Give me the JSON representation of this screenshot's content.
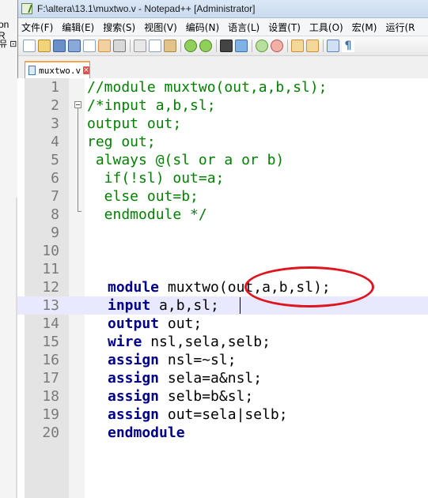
{
  "background_window": {
    "text_line_1": "on R",
    "text_line_2": "뮤 ⊡"
  },
  "window": {
    "title": "F:\\altera\\13.1\\muxtwo.v - Notepad++ [Administrator]"
  },
  "menu": [
    {
      "label": "文件(F)"
    },
    {
      "label": "编辑(E)"
    },
    {
      "label": "搜索(S)"
    },
    {
      "label": "视图(V)"
    },
    {
      "label": "编码(N)"
    },
    {
      "label": "语言(L)"
    },
    {
      "label": "设置(T)"
    },
    {
      "label": "工具(O)"
    },
    {
      "label": "宏(M)"
    },
    {
      "label": "运行(R"
    }
  ],
  "toolbar": {
    "buttons": [
      "new-file",
      "open-file",
      "save",
      "save-all",
      "close",
      "close-all",
      "print",
      "cut",
      "copy",
      "paste",
      "undo",
      "redo",
      "find",
      "replace",
      "zoom-in",
      "zoom-out",
      "sync-v",
      "sync-h",
      "word-wrap",
      "show-all-chars"
    ]
  },
  "tab": {
    "label": "muxtwo.v",
    "close_glyph": "×"
  },
  "editor": {
    "lines": [
      {
        "n": "1",
        "text": "//module muxtwo(out,a,b,sl);",
        "cls": "cm"
      },
      {
        "n": "2",
        "text": "/*input a,b,sl;",
        "cls": "cm"
      },
      {
        "n": "3",
        "text": "output out;",
        "cls": "cm"
      },
      {
        "n": "4",
        "text": "reg out;",
        "cls": "cm"
      },
      {
        "n": "5",
        "text": " always @(sl or a or b)",
        "cls": "cm"
      },
      {
        "n": "6",
        "text": "  if(!sl) out=a;",
        "cls": "cm"
      },
      {
        "n": "7",
        "text": "  else out=b;",
        "cls": "cm"
      },
      {
        "n": "8",
        "text": "  endmodule */",
        "cls": "cm"
      },
      {
        "n": "9",
        "text": "",
        "cls": ""
      },
      {
        "n": "10",
        "text": "",
        "cls": ""
      },
      {
        "n": "11",
        "text": "",
        "cls": ""
      },
      {
        "n": "12",
        "kw": "module",
        "rest": " muxtwo(out,a,b,sl);"
      },
      {
        "n": "13",
        "kw": "input",
        "rest": " a,b,sl;"
      },
      {
        "n": "14",
        "kw": "output",
        "rest": " out;"
      },
      {
        "n": "15",
        "kw": "wire",
        "rest": " nsl,sela,selb;"
      },
      {
        "n": "16",
        "kw": "assign",
        "rest": " nsl=~sl;"
      },
      {
        "n": "17",
        "kw": "assign",
        "rest": " sela=a&nsl;"
      },
      {
        "n": "18",
        "kw": "assign",
        "rest": " selb=b&sl;"
      },
      {
        "n": "19",
        "kw": "assign",
        "rest": " out=sela|selb;"
      },
      {
        "n": "20",
        "kw": "endmodule",
        "rest": ""
      }
    ]
  },
  "colors": {
    "comment": "#008000",
    "keyword": "#00008b",
    "annotation_circle": "#e0141e",
    "current_line": "#e8e8ff"
  }
}
